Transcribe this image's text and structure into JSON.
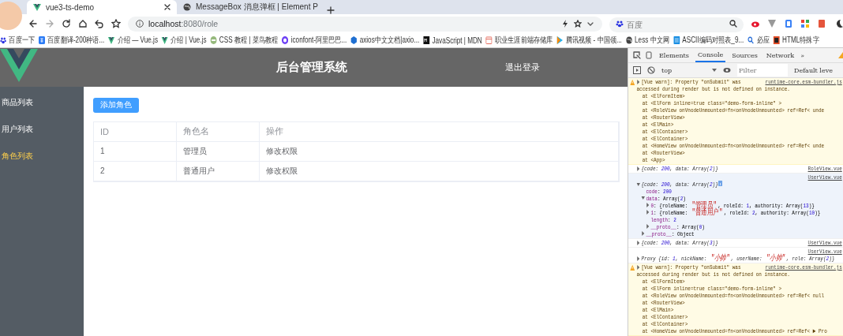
{
  "browser": {
    "tabs": [
      {
        "title": "vue3-ts-demo",
        "selected": true,
        "kind": "vue"
      },
      {
        "title": "MessageBox 消息弹框 | Element P",
        "selected": false,
        "kind": "globe"
      }
    ],
    "url": {
      "host": "localhost",
      "path": ":8080/role"
    },
    "search": {
      "placeholder": "百度"
    },
    "bookmarks": [
      {
        "label": "百度一下",
        "kind": "paw"
      },
      {
        "label": "百度翻译-200种语...",
        "kind": "translate"
      },
      {
        "label": "介绍 — Vue.js",
        "kind": "vue"
      },
      {
        "label": "介绍 | Vue.js",
        "kind": "vue"
      },
      {
        "label": "CSS 教程 | 菜鸟教程",
        "kind": "runoob"
      },
      {
        "label": "iconfont-阿里巴巴...",
        "kind": "iconfont"
      },
      {
        "label": "axios中文文档|axio...",
        "kind": "hex"
      },
      {
        "label": "JavaScript | MDN",
        "kind": "mdn"
      },
      {
        "label": "职业生涯前端存储库",
        "kind": "calendar"
      },
      {
        "label": "腾讯视频 - 中国领...",
        "kind": "play"
      },
      {
        "label": "Less 中文网",
        "kind": "globe"
      },
      {
        "label": "ASCII编码对照表_9...",
        "kind": "table"
      },
      {
        "label": "必应",
        "kind": "search"
      },
      {
        "label": "HTML特殊字",
        "kind": "jb"
      }
    ]
  },
  "app": {
    "title": "后台管理系统",
    "logout": "退出登录",
    "menu": [
      {
        "label": "商品列表",
        "selected": false
      },
      {
        "label": "用户列表",
        "selected": false
      },
      {
        "label": "角色列表",
        "selected": true
      }
    ],
    "add_button": "添加角色",
    "table": {
      "columns": [
        "ID",
        "角色名",
        "操作"
      ],
      "rows": [
        [
          "1",
          "管理员",
          "修改权限"
        ],
        [
          "2",
          "普通用户",
          "修改权限"
        ]
      ]
    }
  },
  "devtools": {
    "tabs": [
      {
        "label": "Elements",
        "selected": false
      },
      {
        "label": "Console",
        "selected": true
      },
      {
        "label": "Sources",
        "selected": false
      },
      {
        "label": "Network",
        "selected": false
      }
    ],
    "more": "»",
    "context": "top",
    "filter_placeholder": "Filter",
    "levels": "Default leve",
    "messages": [
      {
        "kind": "warn",
        "expanded": false,
        "text": "[Vue warn]: Property \"onSubmit\" was",
        "source": "runtime-core.esm-bundler.js",
        "lines": [
          "accessed during render but is not defined on instance.",
          "  at <ElFormItem>",
          "  at <ElForm inline=true class=\"demo-form-inline\" >",
          "  at <RoleView onVnodeUnmounted=fn<onVnodeUnmounted> ref=Ref< unde",
          "  at <RouterView>",
          "  at <ElMain>",
          "  at <ElContainer>",
          "  at <ElContainer>",
          "  at <HomeView onVnodeUnmounted=fn<onVnodeUnmounted> ref=Ref< unde",
          "  at <RouterView>",
          "  at <App>"
        ]
      },
      {
        "kind": "log",
        "expanded": false,
        "text": "{code: 200, data: Array(2)}",
        "source": "RoleView.vue",
        "source_own_line": false
      },
      {
        "kind": "log",
        "expanded": true,
        "text": "{code: 200, data: Array(2)}",
        "source": "UserView.vue",
        "source_own_line": true,
        "children": [
          {
            "kind": "primitive",
            "text": "code: 200"
          },
          {
            "kind": "object",
            "text": "data: Array(2)",
            "expanded": true,
            "children": [
              {
                "kind": "object",
                "text": "0: {roleName: \"管理员\", roleId: 1, authority: Array(13)}",
                "expanded": false
              },
              {
                "kind": "object",
                "text": "1: {roleName: \"普通用户\", roleId: 2, authority: Array(10)}",
                "expanded": false
              },
              {
                "kind": "primitive",
                "text": "length: 2"
              },
              {
                "kind": "object",
                "text": "__proto__: Array(0)",
                "expanded": false
              }
            ]
          },
          {
            "kind": "object",
            "text": "__proto__: Object",
            "expanded": false
          }
        ]
      },
      {
        "kind": "log",
        "expanded": false,
        "text": "{code: 200, data: Array(3)}",
        "source": "UserView.vue",
        "source_own_line": false
      },
      {
        "kind": "log",
        "expanded": false,
        "text": "Proxy {id: 1, nickName: \"小帅\", userName: \"小帅\", role: Array(2)}",
        "source": "UserView.vue",
        "source_own_line": true
      },
      {
        "kind": "warn",
        "expanded": false,
        "text": "[Vue warn]: Property \"onSubmit\" was",
        "source": "runtime-core.esm-bundler.js",
        "lines": [
          "accessed during render but is not defined on instance.",
          "  at <ElFormItem>",
          "  at <ElForm inline=true class=\"demo-form-inline\" >",
          "  at <RoleView onVnodeUnmounted=fn<onVnodeUnmounted> ref=Ref< null",
          "  at <RouterView>",
          "  at <ElMain>",
          "  at <ElContainer>",
          "  at <ElContainer>",
          "  at <HomeView onVnodeUnmounted=fn<onVnodeUnmounted> ref=Ref< ▶ Pro"
        ]
      }
    ]
  }
}
